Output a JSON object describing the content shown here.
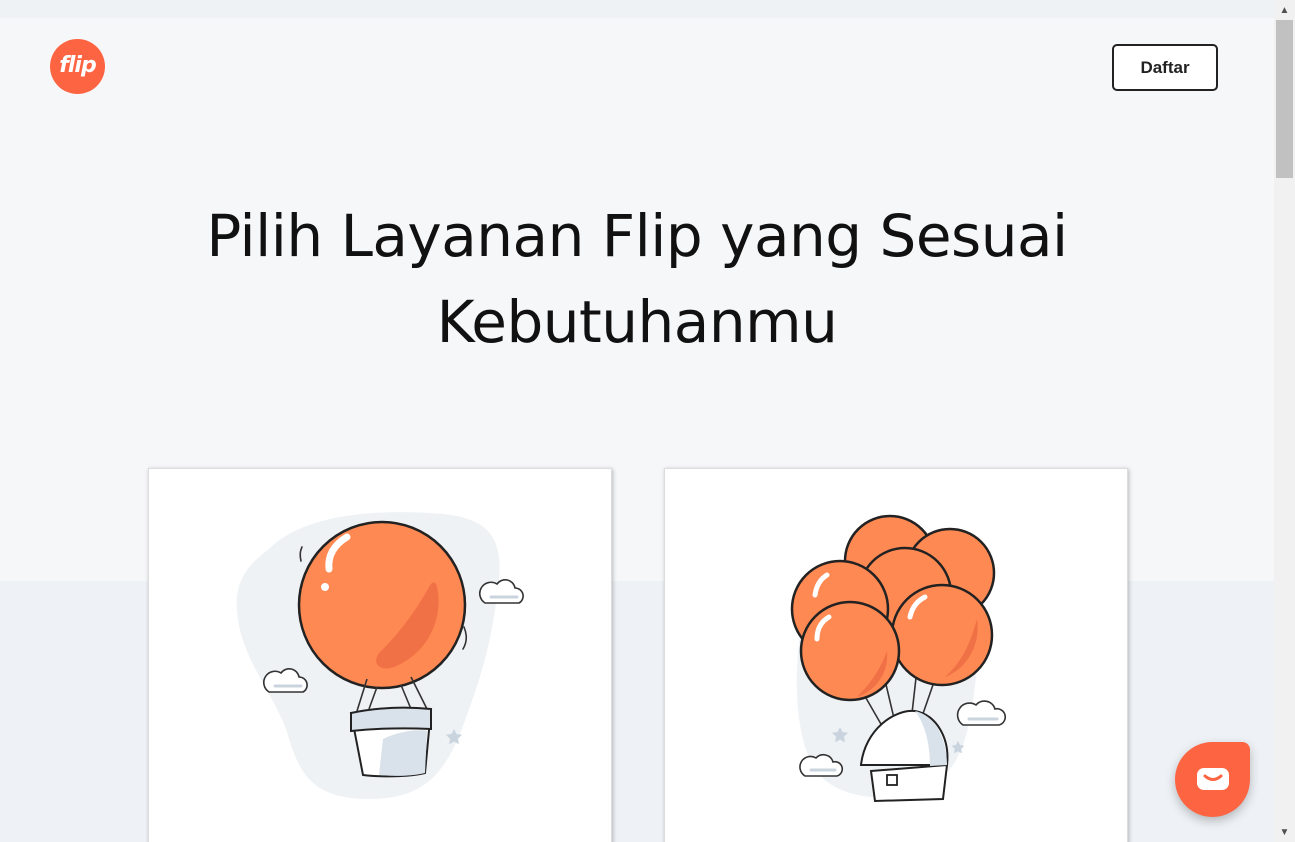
{
  "header": {
    "logo_text": "flip",
    "register_label": "Daftar"
  },
  "hero": {
    "title": "Pilih Layanan Flip yang Sesuai Kebutuhanmu"
  },
  "cards": [
    {
      "illustration": "hot-air-balloon"
    },
    {
      "illustration": "balloon-house"
    }
  ],
  "colors": {
    "brand": "#fd6542",
    "balloon": "#ff8953",
    "balloon_shade": "#f07145"
  },
  "chat": {
    "icon": "chat-bubble-icon"
  }
}
